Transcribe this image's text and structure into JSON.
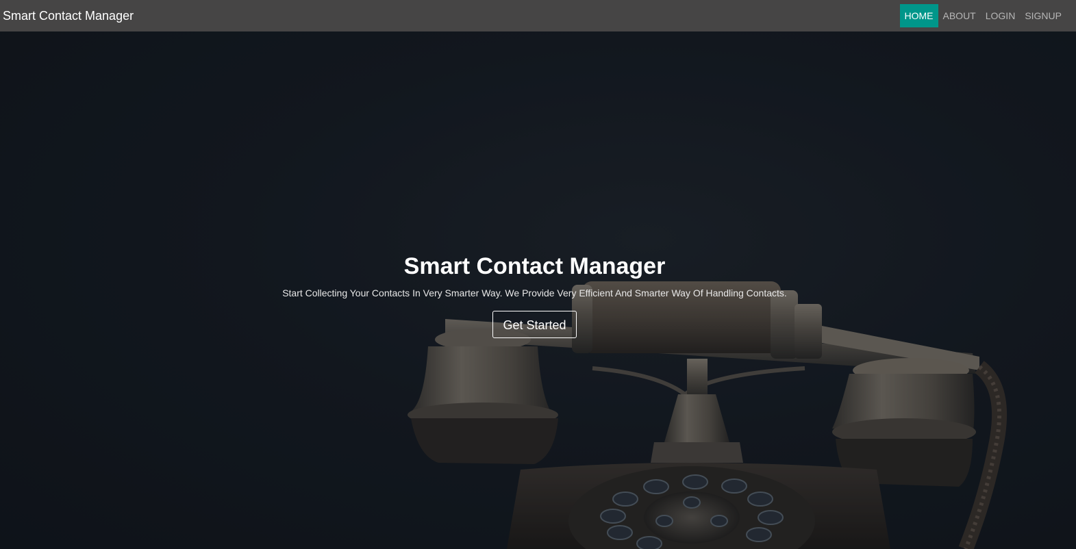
{
  "navbar": {
    "brand": "Smart Contact Manager",
    "links": [
      {
        "label": "HOME",
        "active": true
      },
      {
        "label": "ABOUT",
        "active": false
      },
      {
        "label": "LOGIN",
        "active": false
      },
      {
        "label": "SIGNUP",
        "active": false
      }
    ]
  },
  "hero": {
    "title": "Smart Contact Manager",
    "subtitle": "Start Collecting Your Contacts In Very Smarter Way. We Provide Very Efficient And Smarter Way Of Handling Contacts.",
    "cta_label": "Get Started",
    "background_image": "vintage-telephone"
  },
  "colors": {
    "navbar_bg": "#464545",
    "active_link_bg": "#00968a",
    "hero_bg": "#141a20",
    "text_light": "#ffffff"
  }
}
